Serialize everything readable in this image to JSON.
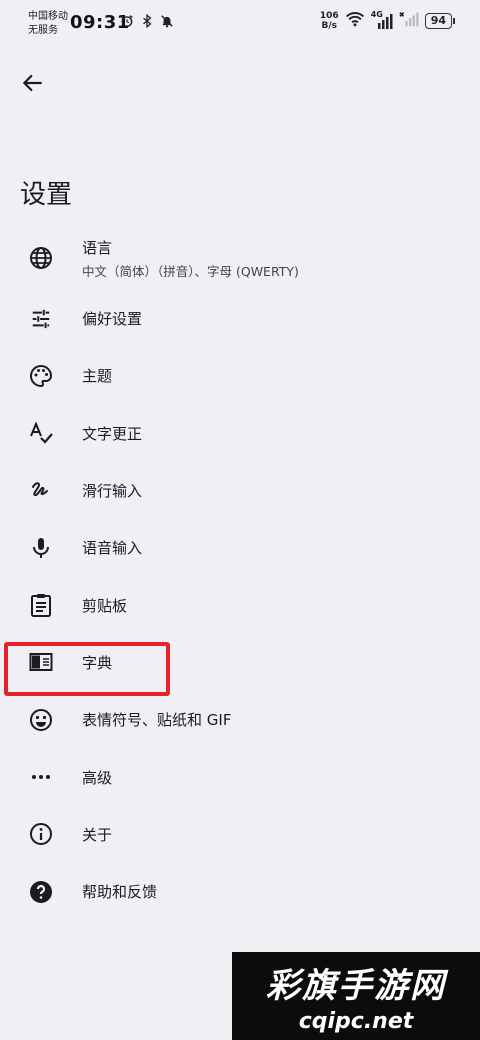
{
  "status": {
    "carrier_line1": "中国移动",
    "carrier_line2": "无服务",
    "time": "09:31",
    "net_speed_value": "106",
    "net_speed_unit": "B/s",
    "network": "4G",
    "battery": "94"
  },
  "header": {
    "title": "设置"
  },
  "items": [
    {
      "label": "语言",
      "sub": "中文（简体）（拼音）、字母 (QWERTY)",
      "icon": "globe-icon"
    },
    {
      "label": "偏好设置",
      "icon": "tune-icon"
    },
    {
      "label": "主题",
      "icon": "palette-icon"
    },
    {
      "label": "文字更正",
      "icon": "spellcheck-icon"
    },
    {
      "label": "滑行输入",
      "icon": "gesture-icon"
    },
    {
      "label": "语音输入",
      "icon": "mic-icon"
    },
    {
      "label": "剪贴板",
      "icon": "clipboard-icon"
    },
    {
      "label": "字典",
      "icon": "dictionary-icon"
    },
    {
      "label": "表情符号、贴纸和 GIF",
      "icon": "emoji-icon"
    },
    {
      "label": "高级",
      "icon": "more-icon"
    },
    {
      "label": "关于",
      "icon": "info-icon"
    },
    {
      "label": "帮助和反馈",
      "icon": "help-icon"
    }
  ],
  "watermark": {
    "title": "彩旗手游网",
    "domain": "cqipc.net"
  },
  "colors": {
    "background": "#f0eff4",
    "highlight": "#e4232a"
  }
}
